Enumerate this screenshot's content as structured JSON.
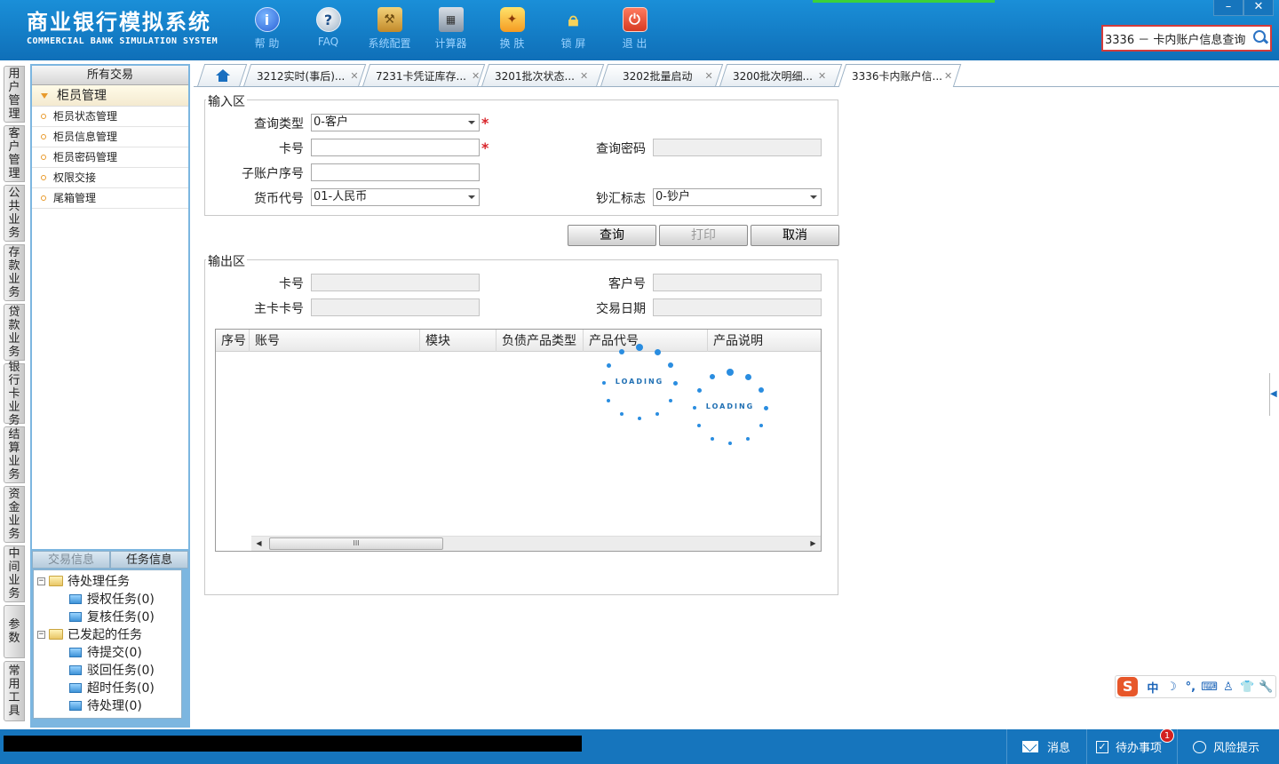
{
  "header": {
    "title_cn": "商业银行模拟系统",
    "title_en": "COMMERCIAL BANK SIMULATION SYSTEM",
    "toolbar": [
      {
        "label": "帮 助",
        "icon": "info-icon",
        "glyph": "i"
      },
      {
        "label": "FAQ",
        "icon": "question-icon",
        "glyph": "?"
      },
      {
        "label": "系统配置",
        "icon": "toolbox-icon",
        "glyph": "⚒"
      },
      {
        "label": "计算器",
        "icon": "calculator-icon",
        "glyph": "▦"
      },
      {
        "label": "换 肤",
        "icon": "shirt-icon",
        "glyph": "👕"
      },
      {
        "label": "锁 屏",
        "icon": "lock-icon",
        "glyph": "🔒"
      },
      {
        "label": "退 出",
        "icon": "power-icon",
        "glyph": "⏻"
      }
    ],
    "search_value": "3336 － 卡内账户信息查询",
    "window_buttons": [
      "–",
      "✕"
    ]
  },
  "vnav": [
    "用户管理",
    "客户管理",
    "公共业务",
    "存款业务",
    "贷款业务",
    "银行卡业务",
    "结算业务",
    "资金业务",
    "中间业务",
    "参数",
    "常用工具"
  ],
  "left_panel": {
    "header": "所有交易",
    "group": "柜员管理",
    "items": [
      "柜员状态管理",
      "柜员信息管理",
      "柜员密码管理",
      "权限交接",
      "尾箱管理"
    ],
    "info_tabs": [
      "交易信息",
      "任务信息"
    ],
    "tree": {
      "pending": "待处理任务",
      "pending_children": [
        "授权任务(0)",
        "复核任务(0)"
      ],
      "initiated": "已发起的任务",
      "initiated_children": [
        "待提交(0)",
        "驳回任务(0)",
        "超时任务(0)",
        "待处理(0)"
      ]
    }
  },
  "tabs": [
    "3212实时(事后)...",
    "7231卡凭证库存...",
    "3201批次状态...",
    "3202批量启动",
    "3200批次明细...",
    "3336卡内账户信..."
  ],
  "input_area": {
    "legend": "输入区",
    "query_type_label": "查询类型",
    "query_type_value": "0-客户",
    "card_no_label": "卡号",
    "card_no_value": "",
    "query_pwd_label": "查询密码",
    "sub_account_label": "子账户序号",
    "sub_account_value": "",
    "currency_label": "货币代号",
    "currency_value": "01-人民币",
    "cash_flag_label": "钞汇标志",
    "cash_flag_value": "0-钞户",
    "required_mark": "*"
  },
  "buttons": {
    "query": "查询",
    "print": "打印",
    "cancel": "取消"
  },
  "output_area": {
    "legend": "输出区",
    "card_no_label": "卡号",
    "customer_no_label": "客户号",
    "main_card_label": "主卡卡号",
    "trade_date_label": "交易日期",
    "columns": [
      "序号",
      "账号",
      "模块",
      "负债产品类型",
      "产品代号",
      "产品说明"
    ],
    "loading_text": "LOADING"
  },
  "status_bar": {
    "messages": "消息",
    "todo": "待办事项",
    "todo_badge": "1",
    "risk": "风险提示"
  },
  "ime": {
    "logo": "S",
    "items": [
      "中",
      "☽",
      "°,",
      "⌨",
      "♙",
      "👕",
      "🔧"
    ]
  },
  "colors": {
    "header": "#1675bd",
    "accent_red": "#d8242a",
    "spinner": "#2a8de0"
  }
}
